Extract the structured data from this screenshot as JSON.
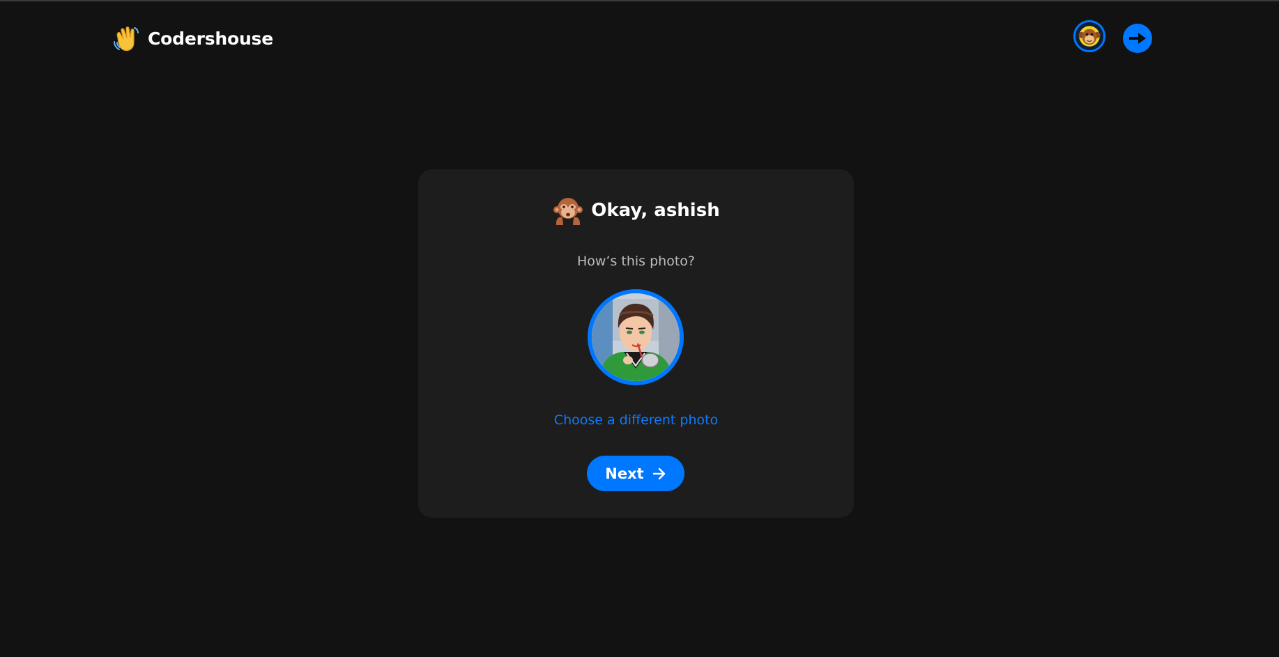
{
  "header": {
    "brand_name": "Codershouse",
    "brand_icon": "waving-hand-icon",
    "logout_icon": "arrow-right-icon"
  },
  "card": {
    "heading_emoji": "see-no-evil-monkey-icon",
    "heading": "Okay, ashish",
    "subtitle": "How’s this photo?",
    "choose_link": "Choose a different photo",
    "next_label": "Next",
    "next_icon": "arrow-right-icon"
  },
  "colors": {
    "background": "#121212",
    "card": "#1d1d1d",
    "accent": "#0077ff",
    "link": "#0d7bff",
    "subtitle": "#bdbdbd"
  }
}
